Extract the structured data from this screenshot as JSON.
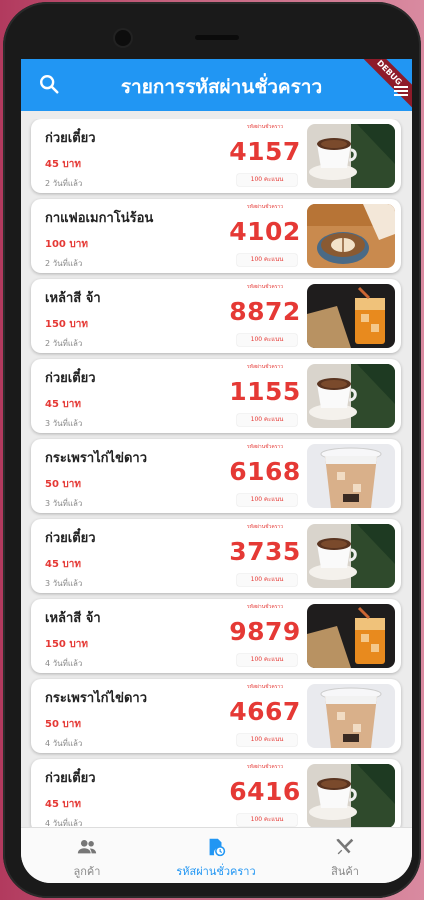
{
  "app": {
    "title": "รายการรหัสผ่านชั่วคราว",
    "debug_banner": "DEBUG",
    "accent": "#2196f3",
    "code_color": "#e53935"
  },
  "list": {
    "code_label": "รหัสผ่านชั่วคราว",
    "items": [
      {
        "name": "ก่วยเตี๋ยว",
        "price": "45 บาท",
        "time": "2 วันที่แล้ว",
        "code": "4157",
        "points": "100 คะแนน",
        "image": "coffee-cup"
      },
      {
        "name": "กาแฟอเมกาโน่ร้อน",
        "price": "100 บาท",
        "time": "2 วันที่แล้ว",
        "code": "4102",
        "points": "100 คะแนน",
        "image": "latte-art"
      },
      {
        "name": "เหล้าสี จ้า",
        "price": "150 บาท",
        "time": "2 วันที่แล้ว",
        "code": "8872",
        "points": "100 คะแนน",
        "image": "iced-drink"
      },
      {
        "name": "ก่วยเตี๋ยว",
        "price": "45 บาท",
        "time": "3 วันที่แล้ว",
        "code": "1155",
        "points": "100 คะแนน",
        "image": "coffee-cup"
      },
      {
        "name": "กระเพราไก่ไข่ดาว",
        "price": "50 บาท",
        "time": "3 วันที่แล้ว",
        "code": "6168",
        "points": "100 คะแนน",
        "image": "iced-coffee-cup"
      },
      {
        "name": "ก่วยเตี๋ยว",
        "price": "45 บาท",
        "time": "3 วันที่แล้ว",
        "code": "3735",
        "points": "100 คะแนน",
        "image": "coffee-cup"
      },
      {
        "name": "เหล้าสี จ้า",
        "price": "150 บาท",
        "time": "4 วันที่แล้ว",
        "code": "9879",
        "points": "100 คะแนน",
        "image": "iced-drink"
      },
      {
        "name": "กระเพราไก่ไข่ดาว",
        "price": "50 บาท",
        "time": "4 วันที่แล้ว",
        "code": "4667",
        "points": "100 คะแนน",
        "image": "iced-coffee-cup"
      },
      {
        "name": "ก่วยเตี๋ยว",
        "price": "45 บาท",
        "time": "4 วันที่แล้ว",
        "code": "6416",
        "points": "100 คะแนน",
        "image": "coffee-cup"
      }
    ]
  },
  "bottom_nav": {
    "items": [
      {
        "label": "ลูกค้า",
        "icon": "people-icon",
        "active": false
      },
      {
        "label": "รหัสผ่านชั่วคราว",
        "icon": "clock-doc-icon",
        "active": true
      },
      {
        "label": "สินค้า",
        "icon": "utensils-icon",
        "active": false
      }
    ]
  }
}
